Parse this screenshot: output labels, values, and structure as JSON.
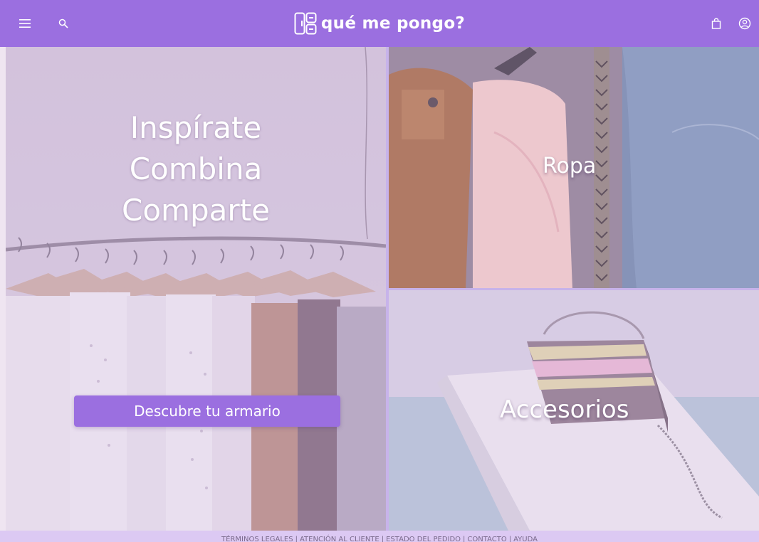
{
  "header": {
    "brand": "qué me pongo?",
    "icons": [
      "menu-icon",
      "search-icon",
      "shopping-bag-icon",
      "user-account-icon"
    ]
  },
  "hero": {
    "lines": [
      "Inspírate",
      "Combina",
      "Comparte"
    ],
    "cta_label": "Descubre tu armario"
  },
  "categories": {
    "ropa": "Ropa",
    "accesorios": "Accesorios"
  },
  "footer": {
    "links": [
      "TÉRMINOS LEGALES",
      "ATENCIÓN AL CLIENTE",
      "ESTADO DEL PEDIDO",
      "CONTACTO",
      "AYUDA"
    ]
  },
  "colors": {
    "brand": "#9b6fe0",
    "footer_bg": "#dcc9f3",
    "overlay": "#d9c8f0"
  }
}
